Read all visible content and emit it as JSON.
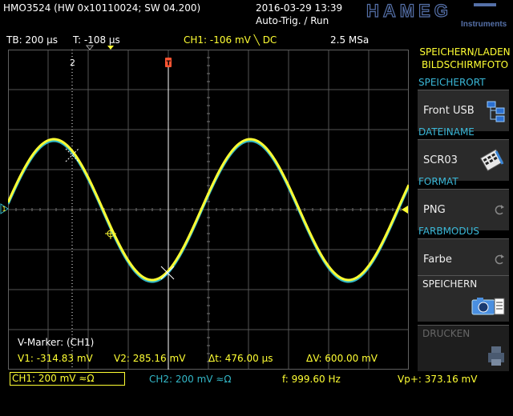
{
  "header": {
    "device_info": "HMO3524 (HW 0x10110024; SW 04.200)",
    "datetime": "2016-03-29 13:39",
    "trigger_mode": "Auto-Trig. / Run",
    "logo_text": "HAMEG",
    "logo_sub": "Instruments"
  },
  "status": {
    "timebase": "TB: 200 µs",
    "trigger_time": "T: -108 µs",
    "ch1_trigger": "CH1: -106 mV ╲ DC",
    "sample_rate": "2.5 MSa"
  },
  "screen": {
    "marker2_label": "2",
    "trigger_marker_label": "T",
    "marker_title": "V-Marker: (CH1)",
    "v1": "V1: -314.83 mV",
    "v2": "V2: 285.16 mV",
    "dt": "Δt: 476.00 µs",
    "dv": "ΔV: 600.00 mV",
    "ch1_ref_label": "1"
  },
  "softmenu": {
    "title_line1": "SPEICHERN/LADEN",
    "title_line2": "BILDSCHIRMFOTO",
    "speicherort_label": "SPEICHERORT",
    "speicherort_value": "Front USB",
    "dateiname_label": "DATEINAME",
    "dateiname_value": "SCR03",
    "format_label": "FORMAT",
    "format_value": "PNG",
    "farbmodus_label": "FARBMODUS",
    "farbmodus_value": "Farbe",
    "speichern_label": "SPEICHERN",
    "drucken_label": "DRUCKEN"
  },
  "bottom": {
    "ch1": "CH1: 200 mV ≈Ω",
    "ch2": "CH2: 200 mV ≈Ω",
    "freq": "f: 999.60 Hz",
    "vp": "Vp+: 373.16 mV"
  },
  "colors": {
    "ch1": "#ffff33",
    "ch2": "#33b8c8",
    "menu_label": "#3ab8d8",
    "trigger": "#ff5533"
  }
}
